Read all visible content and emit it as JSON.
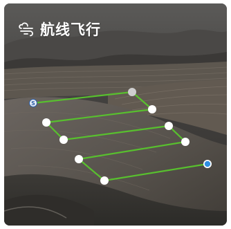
{
  "header": {
    "title": "航线飞行",
    "icon": "drone-route-icon"
  },
  "route": {
    "start_label": "S",
    "line_color": "#58c02e",
    "waypoint_color": "#ffffff",
    "end_color": "#2f8fe3"
  }
}
